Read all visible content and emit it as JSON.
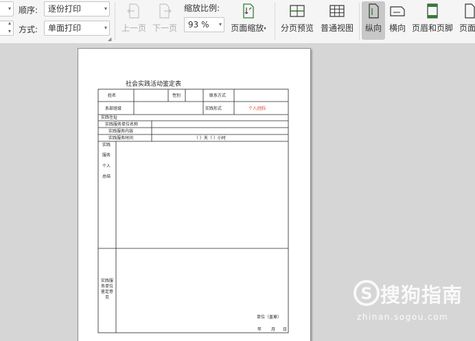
{
  "toolbar": {
    "order_label": "顺序:",
    "order_value": "逐份打印",
    "mode_label": "方式:",
    "mode_value": "单面打印",
    "zoom_label": "缩放比例:",
    "zoom_value": "93 %",
    "prev_page": "上一页",
    "next_page": "下一页",
    "page_scale": "页面缩放",
    "page_break_preview": "分页预览",
    "normal_view": "普通视图",
    "portrait": "纵向",
    "landscape": "横向",
    "header_footer": "页眉和页脚",
    "page_setup": "页面"
  },
  "sheet": {
    "title": "社会实践活动鉴定表",
    "name": "姓名",
    "gender": "性别",
    "contact": "联系方式",
    "department": "系部班级",
    "practice_form": "实践形式",
    "practice_form_value": "个人/团队",
    "practice_address": "实践住址",
    "unit_name": "实践服务单位名称",
    "service_content": "实践服务内容",
    "service_time": "实践服务时间",
    "time_value": "（    ）天（    ）小时",
    "summary_chars": [
      "实践",
      "服务",
      "个人",
      "总结"
    ],
    "unit_opinion_lines": [
      "实践服",
      "务单位",
      "鉴定意",
      "见"
    ],
    "seal": "单位（盖章）",
    "year": "年",
    "month": "月",
    "day": "日"
  },
  "watermark": {
    "brand": "搜狗指南",
    "url": "zhinan.sogou.com"
  }
}
